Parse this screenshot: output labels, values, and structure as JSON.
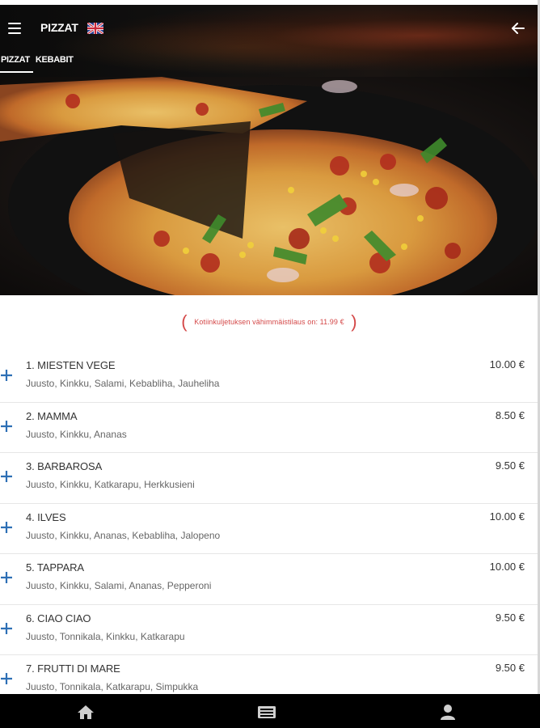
{
  "header": {
    "title": "PIZZAT",
    "language_icon": "uk-flag-icon",
    "menu_icon": "hamburger-menu-icon",
    "back_icon": "arrow-left-icon"
  },
  "tabs": [
    {
      "label": "PIZZAT",
      "active": true
    },
    {
      "label": "KEBABIT",
      "active": false
    }
  ],
  "notice": {
    "text": "Kotiinkuljetuksen vähimmäistilaus on: 11.99 €"
  },
  "menu": [
    {
      "name": "1. MIESTEN VEGE",
      "description": "Juusto, Kinkku, Salami, Kebabliha, Jauheliha",
      "price": "10.00 €"
    },
    {
      "name": "2. MAMMA",
      "description": "Juusto, Kinkku, Ananas",
      "price": "8.50 €"
    },
    {
      "name": "3. BARBAROSA",
      "description": "Juusto, Kinkku, Katkarapu, Herkkusieni",
      "price": "9.50 €"
    },
    {
      "name": "4. ILVES",
      "description": "Juusto, Kinkku, Ananas, Kebabliha, Jalopeno",
      "price": "10.00 €"
    },
    {
      "name": "5. TAPPARA",
      "description": "Juusto, Kinkku, Salami, Ananas, Pepperoni",
      "price": "10.00 €"
    },
    {
      "name": "6. CIAO CIAO",
      "description": "Juusto, Tonnikala, Kinkku, Katkarapu",
      "price": "9.50 €"
    },
    {
      "name": "7. FRUTTI DI MARE",
      "description": "Juusto, Tonnikala, Katkarapu, Simpukka",
      "price": "9.50 €"
    }
  ],
  "bottom_nav": [
    {
      "icon": "home-icon"
    },
    {
      "icon": "menu-list-icon"
    },
    {
      "icon": "user-icon"
    }
  ],
  "colors": {
    "header_bg": "#0f0e0d",
    "accent_blue": "#2d6fb5",
    "notice_red": "#d44848",
    "nav_bg": "#000000"
  }
}
